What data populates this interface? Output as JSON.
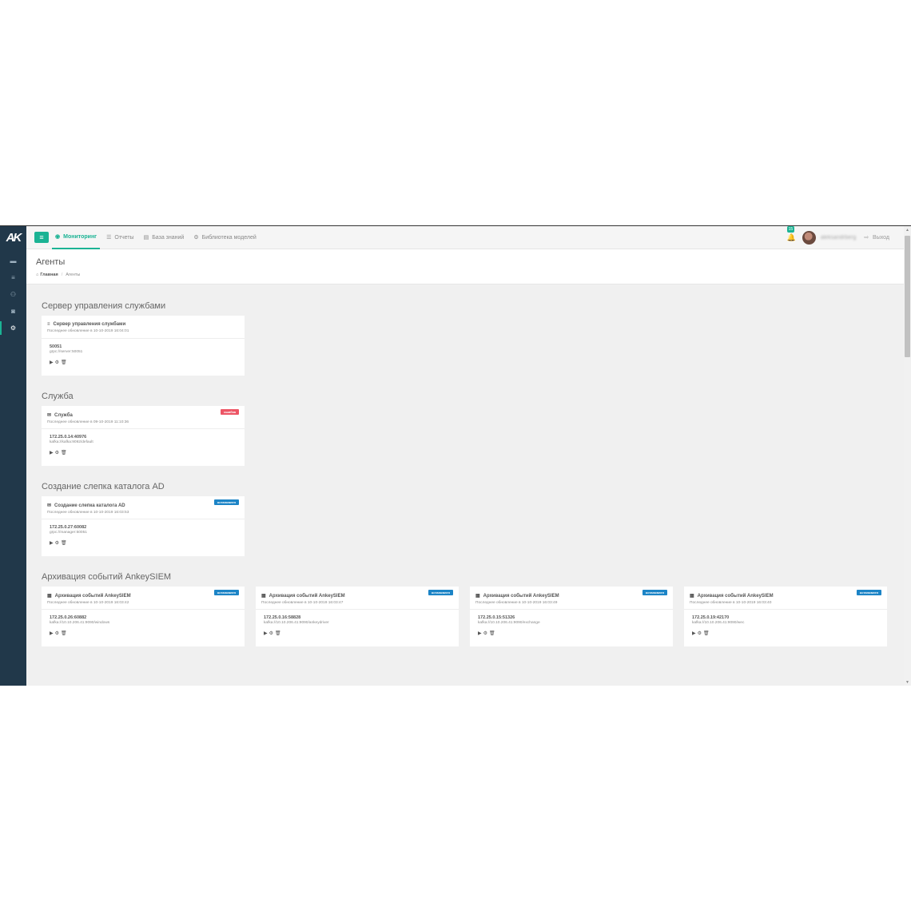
{
  "app": {
    "logo": "AK"
  },
  "sidebar": {
    "items": [
      {
        "icon": "bed-icon",
        "glyph": "▬",
        "active": false
      },
      {
        "icon": "list-icon",
        "glyph": "≡",
        "active": false
      },
      {
        "icon": "users-icon",
        "glyph": "⚇",
        "active": false
      },
      {
        "icon": "car-icon",
        "glyph": "◙",
        "active": false
      },
      {
        "icon": "cogs-icon",
        "glyph": "⚙",
        "active": true
      }
    ]
  },
  "topnav": {
    "menu_glyph": "≡",
    "items": [
      {
        "label": "Мониторинг",
        "glyph": "◉",
        "active": true
      },
      {
        "label": "Отчеты",
        "glyph": "☰",
        "active": false
      },
      {
        "label": "База знаний",
        "glyph": "▤",
        "active": false
      },
      {
        "label": "Библиотека моделей",
        "glyph": "⚙",
        "active": false
      }
    ],
    "notifications_count": "15",
    "bell_glyph": "🔔",
    "username": "aleksandrberg",
    "logout_label": "Выход",
    "logout_glyph": "⇨"
  },
  "header": {
    "title": "Агенты",
    "breadcrumb_home": "Главная",
    "breadcrumb_home_glyph": "⌂",
    "breadcrumb_sep": "/",
    "breadcrumb_current": "Агенты"
  },
  "sections": [
    {
      "title": "Сервер управления службами",
      "cards": [
        {
          "icon": "≡",
          "name": "Сервер управления службами",
          "updated": "Последнее обновление в 10-10-2019 16:04:01",
          "status": "",
          "endpoint": "50051",
          "url": "grpc://server:50051"
        }
      ]
    },
    {
      "title": "Служба",
      "cards": [
        {
          "icon": "✉",
          "name": "Служба",
          "updated": "Последнее обновление в 09-10-2019 11:10:36",
          "status": "ошибка",
          "status_type": "error",
          "endpoint": "172.25.0.14:40976",
          "url": "kafka://kafka:9092/default"
        }
      ]
    },
    {
      "title": "Создание слепка каталога AD",
      "cards": [
        {
          "icon": "✉",
          "name": "Создание слепка каталога AD",
          "updated": "Последнее обновление в 10-10-2019 16:03:53",
          "status": "остановлен",
          "status_type": "stopped",
          "endpoint": "172.25.0.27:60082",
          "url": "grpc://manager:50051"
        }
      ]
    },
    {
      "title": "Архивация событий AnkeySIEM",
      "cards": [
        {
          "icon": "▦",
          "name": "Архивация событий AnkeySIEM",
          "updated": "Последнее обновление в 10-10-2019 16:03:42",
          "status": "остановлен",
          "status_type": "stopped",
          "endpoint": "172.25.0.26:60882",
          "url": "kafka://10.10.206.41:9090/windows"
        },
        {
          "icon": "▦",
          "name": "Архивация событий AnkeySIEM",
          "updated": "Последнее обновление в 10-10-2019 16:03:47",
          "status": "остановлен",
          "status_type": "stopped",
          "endpoint": "172.25.0.16:58828",
          "url": "kafka://10.10.206.41:9090/ankeydriver"
        },
        {
          "icon": "▦",
          "name": "Архивация событий AnkeySIEM",
          "updated": "Последнее обновление в 10-10-2019 16:03:49",
          "status": "остановлен",
          "status_type": "stopped",
          "endpoint": "172.25.0.15:51326",
          "url": "kafka://10.10.206.41:9090/exchange"
        },
        {
          "icon": "▦",
          "name": "Архивация событий AnkeySIEM",
          "updated": "Последнее обновление в 10-10-2019 16:03:40",
          "status": "остановлен",
          "status_type": "stopped",
          "endpoint": "172.25.0.19:42170",
          "url": "kafka://10.10.206.41:9090/wec"
        }
      ]
    }
  ],
  "card_actions": {
    "play_glyph": "▶",
    "settings_glyph": "⚙",
    "delete_glyph": "🗑"
  },
  "colors": {
    "accent": "#1bb394",
    "sidebar": "#21384a",
    "badge_stopped": "#1c84c6",
    "badge_error": "#ed5565"
  }
}
